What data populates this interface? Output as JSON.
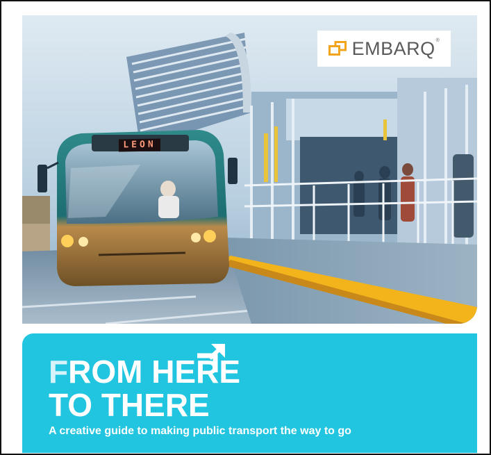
{
  "cover": {
    "brand": {
      "name": "EMBARQ",
      "trademark": "®",
      "mark_color": "#f2a41c"
    },
    "photo": {
      "bus_destination_sign": "LEON"
    },
    "title": {
      "line1_initial": "F",
      "line1_rest": "ROM HERE",
      "line2": "TO THERE"
    },
    "subtitle": "A creative guide to making public transport the way to go",
    "colors": {
      "panel": "#21c5e0",
      "title_text": "#ffffff",
      "curb_yellow": "#f2b41a"
    }
  }
}
